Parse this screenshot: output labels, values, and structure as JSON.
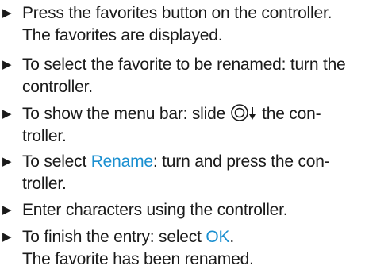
{
  "steps": [
    {
      "text": "Press the favorites button on the controller.",
      "result": "The favorites are displayed."
    },
    {
      "text": "To select the favorite to be renamed: turn the controller."
    },
    {
      "before": "To show the menu bar: slide",
      "icon": "controller-slide-down-icon",
      "after": "the con-troller."
    },
    {
      "before": "To select ",
      "highlight": "Rename",
      "after": ": turn and press the con-troller."
    },
    {
      "text": "Enter characters using the controller."
    },
    {
      "before": "To finish the entry: select ",
      "highlight": "OK",
      "after": ".",
      "result": "The favorite has been renamed."
    }
  ],
  "bullet_icon": "triangle-right-icon",
  "colors": {
    "text": "#1a1a1a",
    "highlight": "#1a8fd0"
  }
}
